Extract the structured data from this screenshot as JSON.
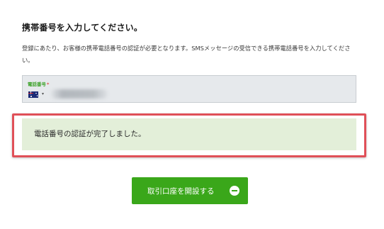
{
  "form": {
    "title": "携帯番号を入力してください。",
    "description": "登録にあたり、お客様の携帯電話番号の認証が必要となります。SMSメッセージの受信できる携帯電話番号を入力してください。",
    "phone": {
      "label": "電話番号",
      "required_mark": "*",
      "country_flag": "australia-flag-icon",
      "dropdown_caret": "▾",
      "value_blurred": true
    }
  },
  "alert": {
    "message": "電話番号の認証が完了しました。",
    "background_color": "#e3efd9",
    "highlight_color": "#e05058"
  },
  "actions": {
    "open_account_label": "取引口座を開設する",
    "button_color": "#3aa71a",
    "button_icon": "minus-circle-icon"
  }
}
